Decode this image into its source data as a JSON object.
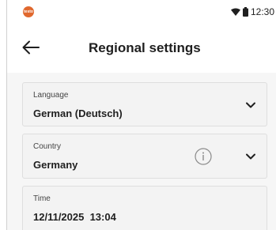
{
  "status_bar": {
    "app_logo_text": "testo",
    "time": "12:30",
    "icons": [
      "wifi-icon",
      "battery-icon"
    ]
  },
  "header": {
    "title": "Regional settings",
    "back_icon": "arrow-left-icon"
  },
  "settings": {
    "language": {
      "label": "Language",
      "value": "German (Deutsch)"
    },
    "country": {
      "label": "Country",
      "value": "Germany"
    },
    "time": {
      "label": "Time",
      "value": "12/11/2025  13:04"
    }
  },
  "colors": {
    "brand": "#e0682e",
    "text": "#1f1f1f",
    "field_bg": "#f3f3f3",
    "page_bg": "#f6f6f6"
  }
}
